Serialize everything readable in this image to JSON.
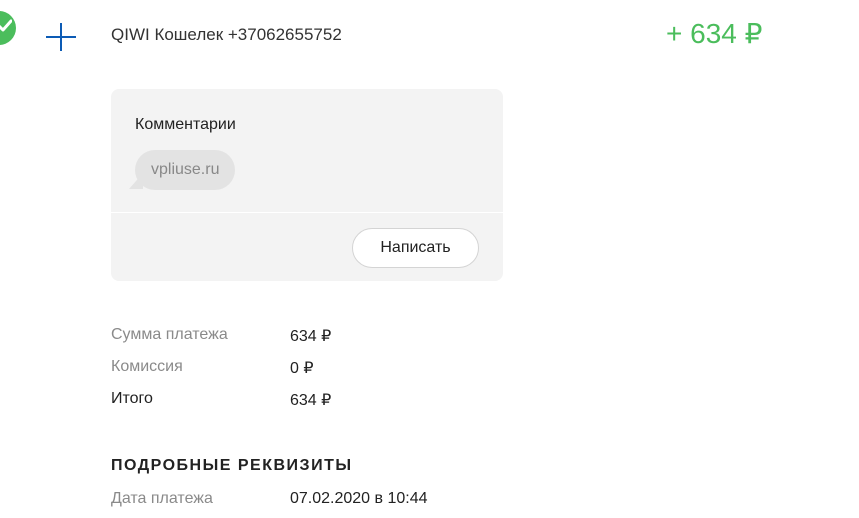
{
  "transaction": {
    "status": "success",
    "payee": "QIWI Кошелек +37062655752",
    "amount": "+ 634 ₽",
    "colors": {
      "accent_green": "#4bbd5c",
      "icon_blue": "#0c5bb5"
    }
  },
  "comments": {
    "title": "Комментарии",
    "items": [
      {
        "text": "vpliuse.ru"
      }
    ],
    "write_button_label": "Написать"
  },
  "summary": {
    "rows": [
      {
        "label": "Сумма платежа",
        "value": "634 ₽"
      },
      {
        "label": "Комиссия",
        "value": "0 ₽"
      },
      {
        "label": "Итого",
        "value": "634 ₽"
      }
    ]
  },
  "details": {
    "title": "ПОДРОБНЫЕ РЕКВИЗИТЫ",
    "rows": [
      {
        "label": "Дата платежа",
        "value": "07.02.2020 в 10:44"
      }
    ]
  },
  "icons": {
    "status": "check-circle-icon",
    "type": "plus-icon"
  }
}
